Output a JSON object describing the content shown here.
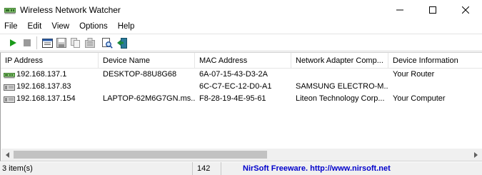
{
  "window": {
    "title": "Wireless Network Watcher",
    "controls": {
      "minimize": "─",
      "maximize": "☐",
      "close": "✕"
    }
  },
  "menu": [
    "File",
    "Edit",
    "View",
    "Options",
    "Help"
  ],
  "toolbar": {
    "icons": [
      "play-icon",
      "stop-icon",
      "properties-icon",
      "save-icon",
      "copy-icon",
      "html-report-icon",
      "find-icon",
      "exit-icon"
    ]
  },
  "list": {
    "columns": [
      "IP Address",
      "Device Name",
      "MAC Address",
      "Network Adapter Comp...",
      "Device Information"
    ],
    "rows": [
      {
        "ip": "192.168.137.1",
        "name": "DESKTOP-88U8G68",
        "mac": "6A-07-15-43-D3-2A",
        "adapter": "",
        "info": "Your Router",
        "icon": "router-icon"
      },
      {
        "ip": "192.168.137.83",
        "name": "",
        "mac": "6C-C7-EC-12-D0-A1",
        "adapter": "SAMSUNG ELECTRO-M...",
        "info": "",
        "icon": "computer-icon"
      },
      {
        "ip": "192.168.137.154",
        "name": "LAPTOP-62M6G7GN.ms...",
        "mac": "F8-28-19-4E-95-61",
        "adapter": "Liteon Technology Corp...",
        "info": "Your Computer",
        "icon": "computer-icon"
      }
    ]
  },
  "status": {
    "count": "3 item(s)",
    "number": "142",
    "link": "NirSoft Freeware.  http://www.nirsoft.net"
  },
  "colors": {
    "link": "#0000cc",
    "play": "#1a9a1a",
    "stop": "#8c8c8c",
    "statusbar": "#f0f0f0"
  }
}
